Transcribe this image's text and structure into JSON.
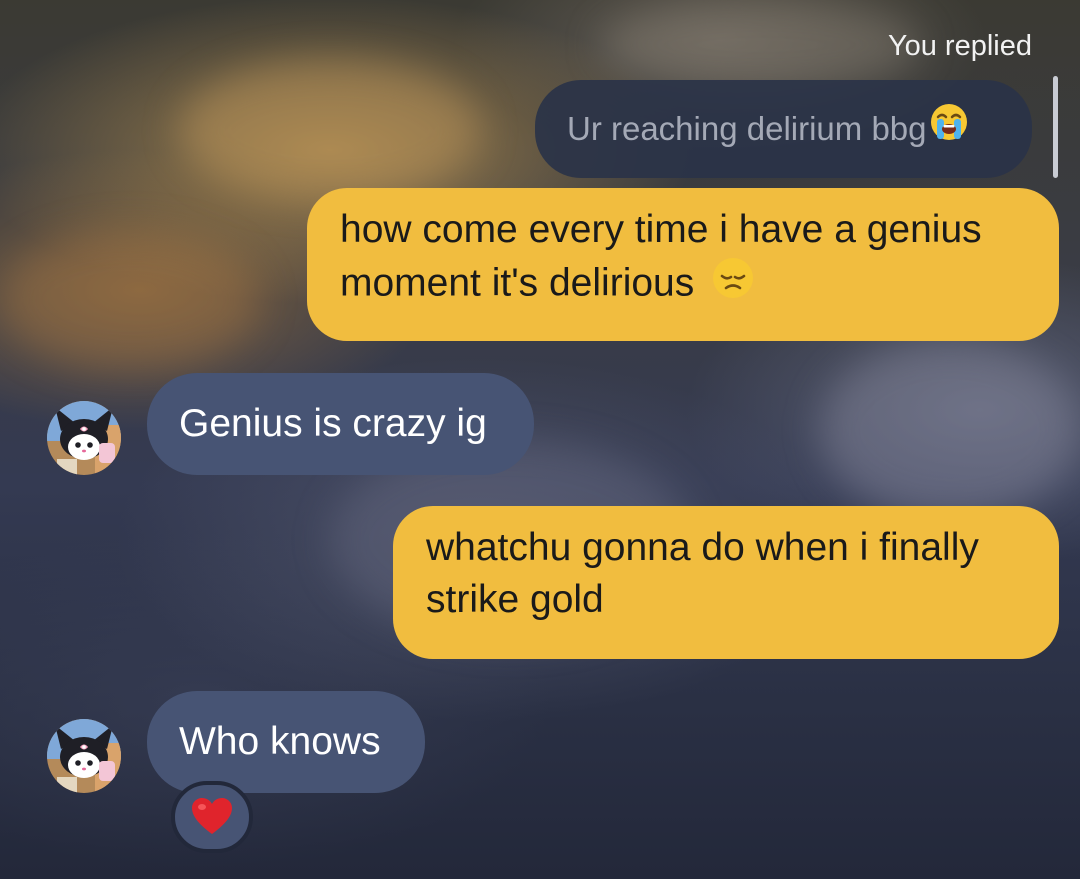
{
  "reply_header": {
    "label": "You replied",
    "quoted_message": "Ur reaching delirium bbg",
    "quoted_emoji": "loudly-crying-face-icon"
  },
  "messages": [
    {
      "direction": "outgoing",
      "line1": "how come every time i have a genius",
      "line2": "moment it's delirious",
      "emoji": "disappointed-face-icon"
    },
    {
      "direction": "incoming",
      "text": "Genius is crazy ig",
      "avatar": "kuromi-avatar-icon"
    },
    {
      "direction": "outgoing",
      "line1": "whatchu gonna do when i finally",
      "line2": "strike gold"
    },
    {
      "direction": "incoming",
      "text": "Who knows",
      "avatar": "kuromi-avatar-icon",
      "reaction": "red-heart-icon"
    }
  ],
  "colors": {
    "outgoing_bubble": "#f1bd3f",
    "incoming_bubble": "#475474",
    "reply_bubble": "#2a3348"
  }
}
